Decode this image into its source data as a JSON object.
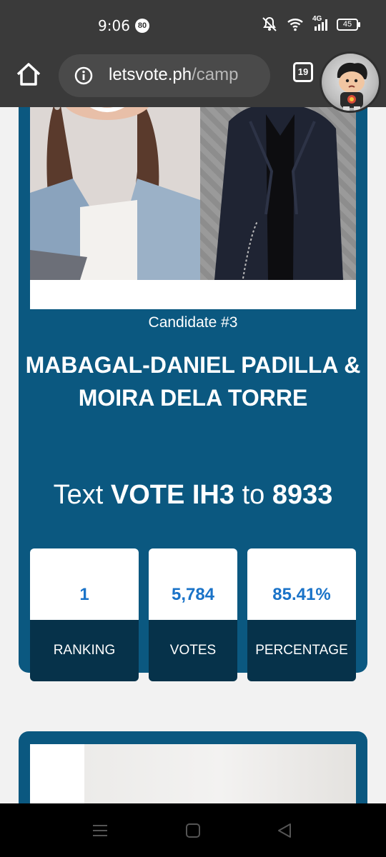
{
  "status_bar": {
    "time": "9:06",
    "notification_count": "80",
    "network": "4G",
    "battery": "45"
  },
  "browser": {
    "url_domain": "letsvote.ph",
    "url_path": "/camp",
    "tab_count": "19"
  },
  "candidate": {
    "number_label": "Candidate #3",
    "name": "MABAGAL-DANIEL PADILLA & MOIRA DELA TORRE",
    "vote_prefix": "Text",
    "vote_code": "VOTE IH3",
    "vote_to": "to",
    "vote_number": "8933"
  },
  "stats": [
    {
      "value": "1",
      "label": "RANKING"
    },
    {
      "value": "5,784",
      "label": "VOTES"
    },
    {
      "value": "85.41%",
      "label": "PERCENTAGE"
    }
  ],
  "colors": {
    "card_blue": "#0b5880",
    "stat_dark": "#06324a",
    "stat_value": "#1a73c8"
  }
}
